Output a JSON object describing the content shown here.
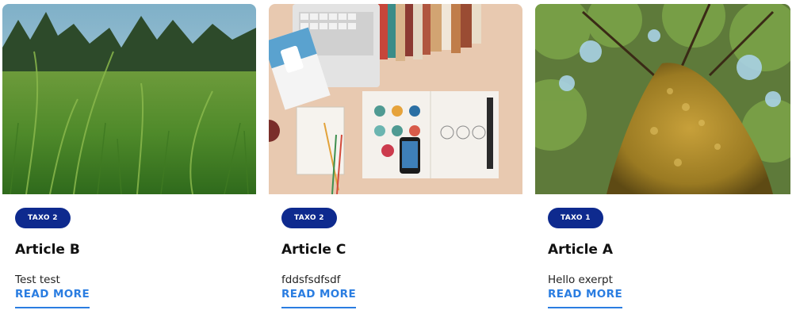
{
  "cards": [
    {
      "image": "grass-field-photo",
      "badge": "TAXO 2",
      "title": "Article B",
      "excerpt": "Test test",
      "read_more": "READ MORE"
    },
    {
      "image": "desk-workspace-photo",
      "badge": "TAXO 2",
      "title": "Article C",
      "excerpt": "fddsfsdfsdf",
      "read_more": "READ MORE"
    },
    {
      "image": "mossy-tree-trunk-photo",
      "badge": "TAXO 1",
      "title": "Article A",
      "excerpt": "Hello exerpt",
      "read_more": "READ MORE"
    }
  ],
  "colors": {
    "badge_bg": "#0e2a8e",
    "link": "#2a7de1",
    "title": "#111111"
  }
}
